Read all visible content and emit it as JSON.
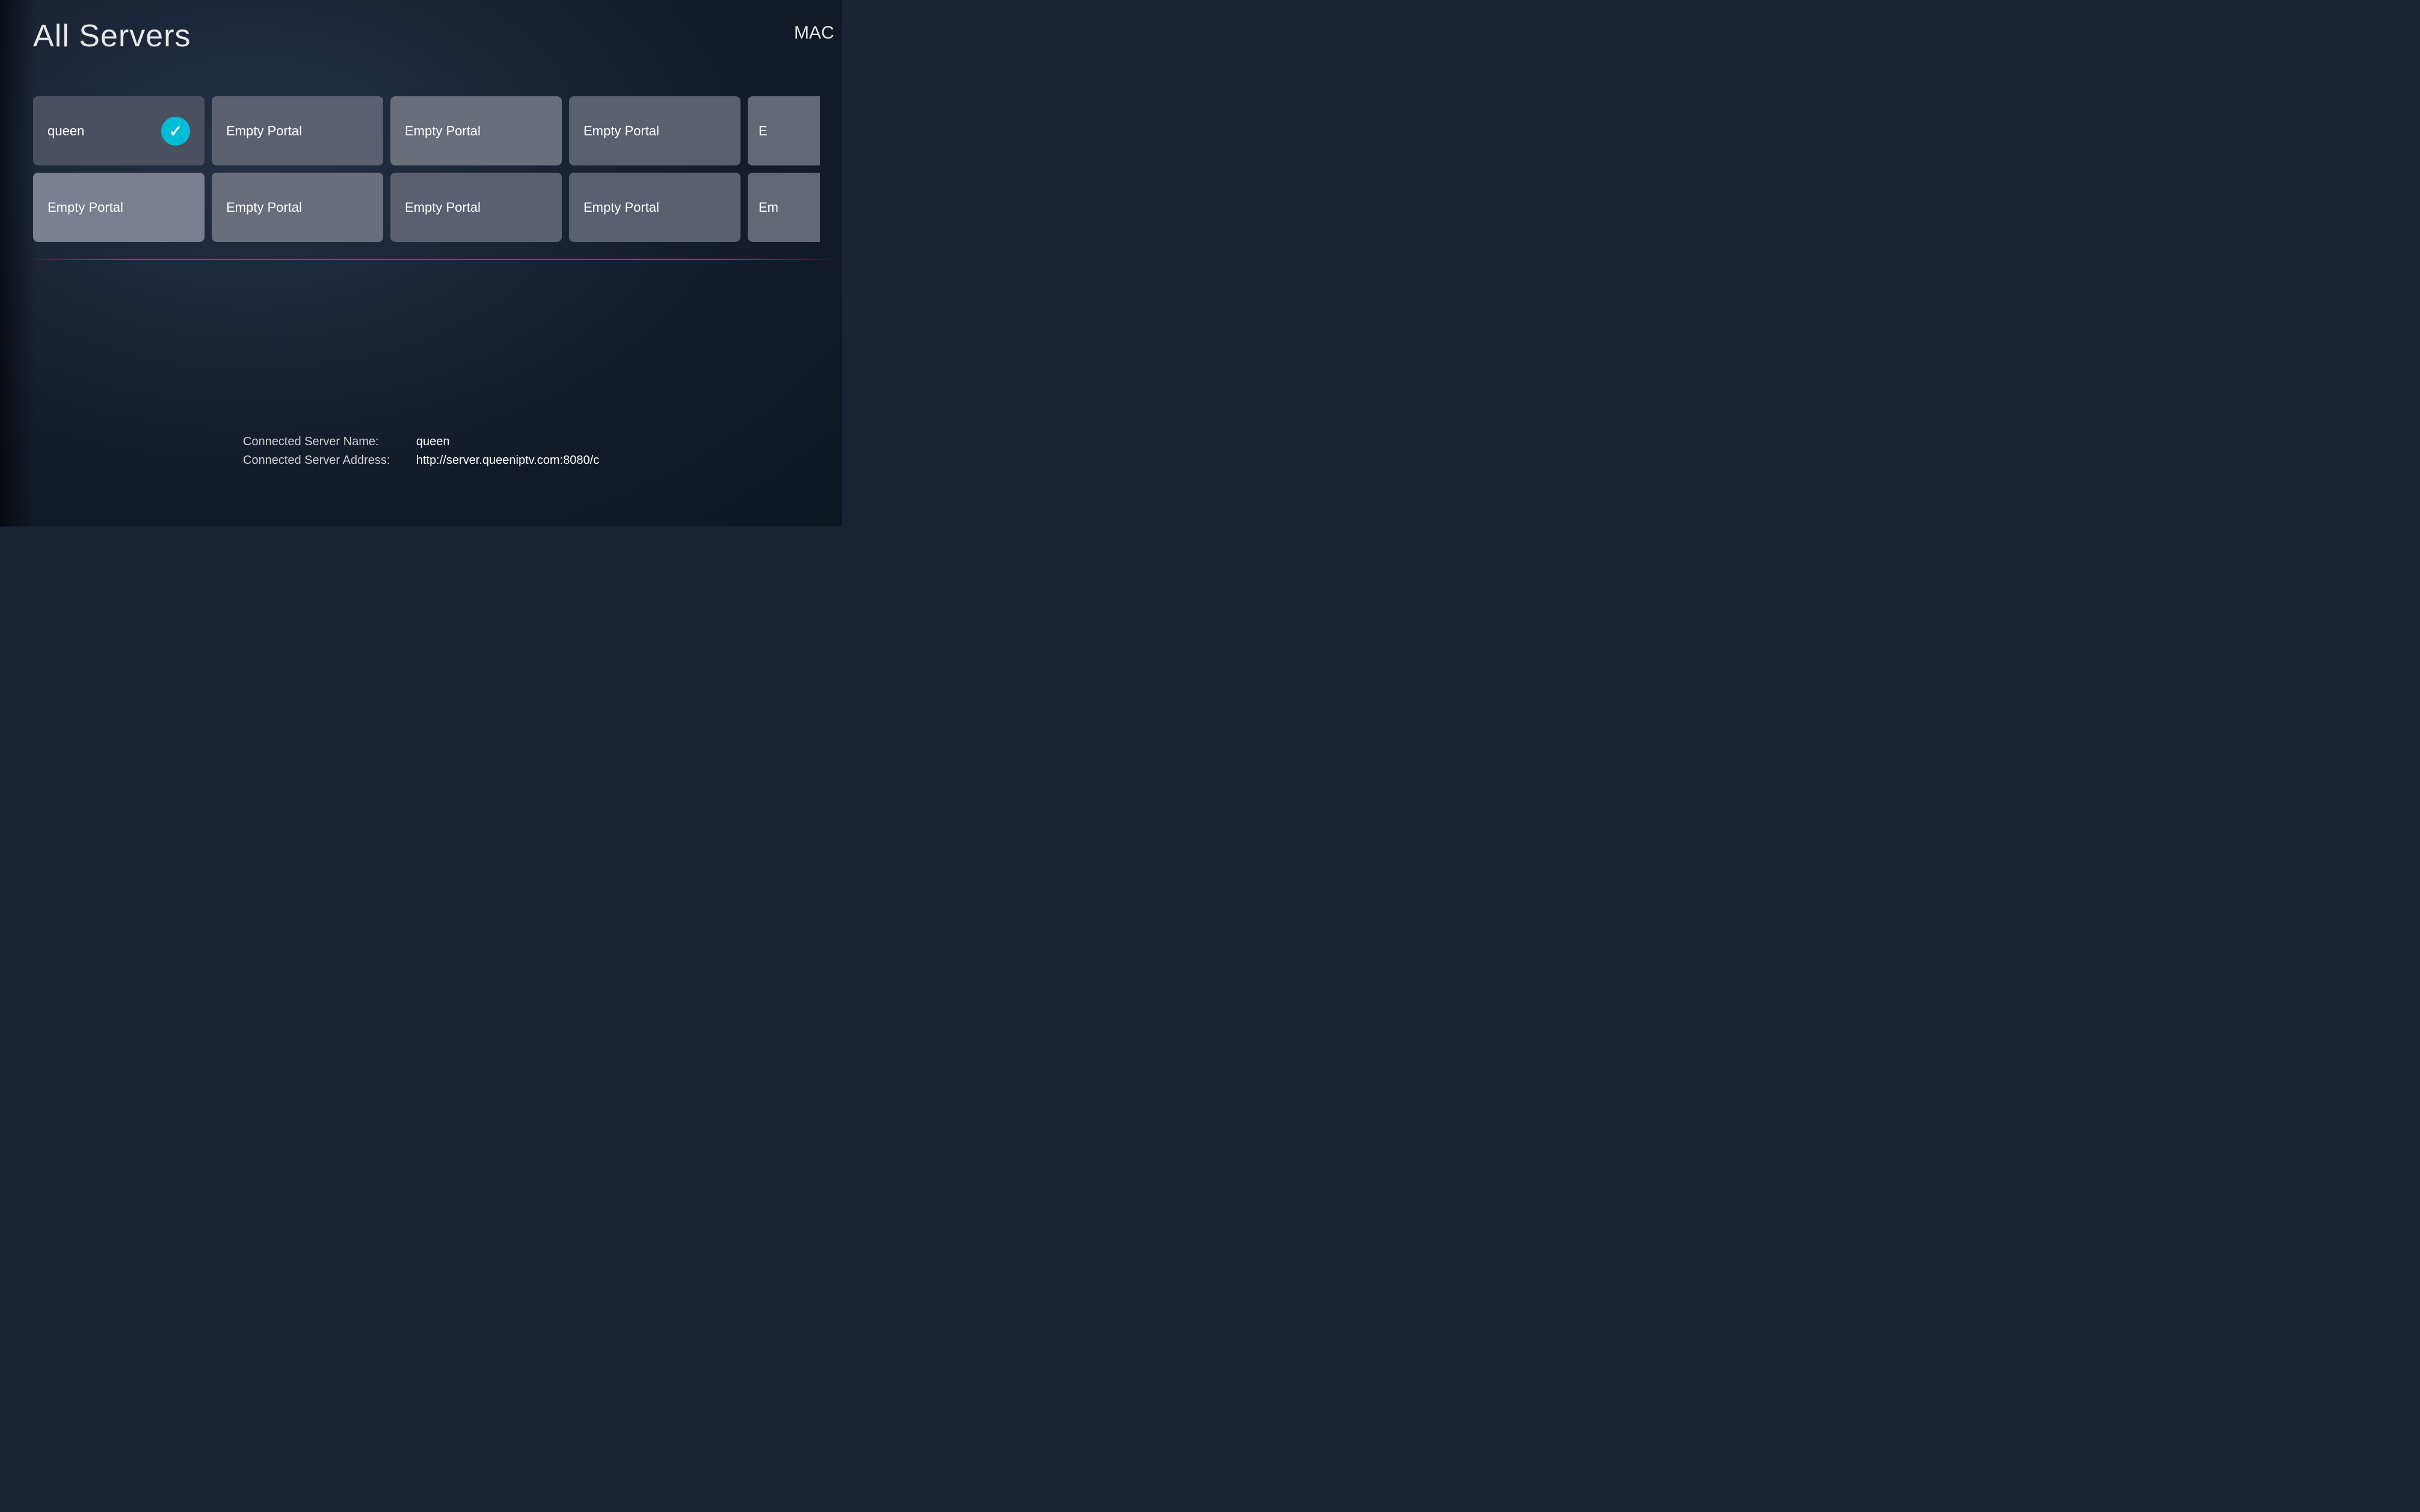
{
  "header": {
    "title": "All Servers",
    "mac_label": "MAC"
  },
  "grid": {
    "tiles": [
      {
        "id": "queen",
        "label": "queen",
        "type": "active-check",
        "row": 1,
        "col": 1
      },
      {
        "id": "empty1",
        "label": "Empty Portal",
        "type": "normal",
        "row": 1,
        "col": 2
      },
      {
        "id": "empty2",
        "label": "Empty Portal",
        "type": "darker",
        "row": 1,
        "col": 3
      },
      {
        "id": "empty3",
        "label": "Empty Portal",
        "type": "normal",
        "row": 1,
        "col": 4
      },
      {
        "id": "empty4-partial",
        "label": "E",
        "type": "partial",
        "row": 1,
        "col": 5
      },
      {
        "id": "empty5",
        "label": "Empty Portal",
        "type": "lighter",
        "row": 2,
        "col": 1
      },
      {
        "id": "empty6",
        "label": "Empty Portal",
        "type": "darker",
        "row": 2,
        "col": 2
      },
      {
        "id": "empty7",
        "label": "Empty Portal",
        "type": "normal",
        "row": 2,
        "col": 3
      },
      {
        "id": "empty8",
        "label": "Empty Portal",
        "type": "normal",
        "row": 2,
        "col": 4
      },
      {
        "id": "empty9-partial",
        "label": "Em",
        "type": "partial",
        "row": 2,
        "col": 5
      }
    ]
  },
  "bottom_info": {
    "server_name_label": "Connected Server Name:",
    "server_name_value": "queen",
    "server_address_label": "Connected Server Address:",
    "server_address_value": "http://server.queeniptv.com:8080/c"
  }
}
